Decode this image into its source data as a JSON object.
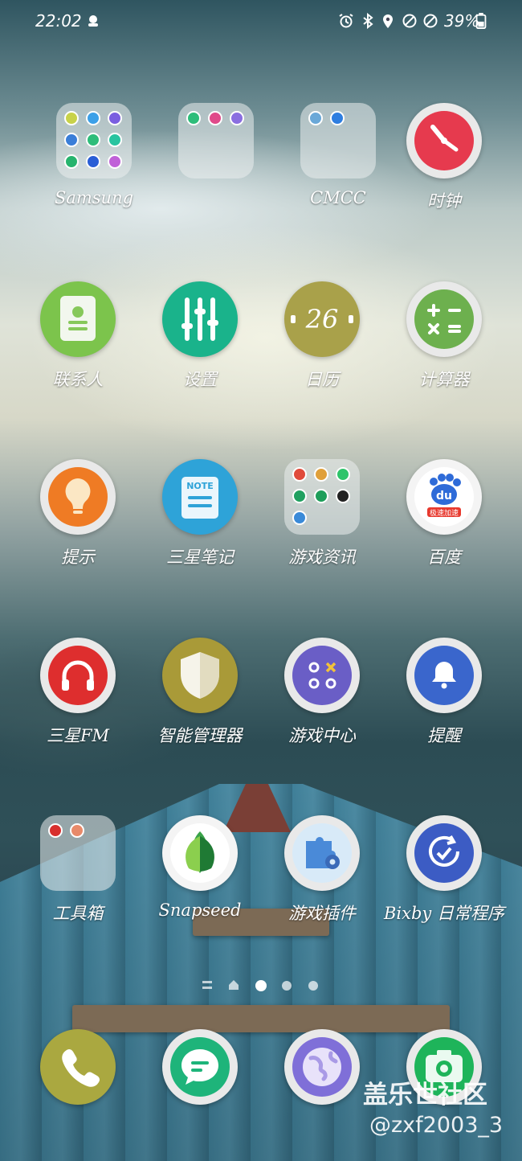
{
  "status_bar": {
    "time": "22:02",
    "battery_percent": "39%",
    "icons": [
      "notification-icon",
      "alarm-icon",
      "bluetooth-icon",
      "location-icon",
      "do-not-disturb-icon",
      "block-icon",
      "battery-icon"
    ]
  },
  "apps": {
    "samsung": {
      "label": "Samsung",
      "type": "folder"
    },
    "cmcc": {
      "label": "CMCC",
      "type": "folder"
    },
    "clock": {
      "label": "时钟",
      "icon": "clock-icon",
      "color": "#e8364c"
    },
    "contacts": {
      "label": "联系人",
      "icon": "contact-icon",
      "color": "#7ac54a"
    },
    "settings": {
      "label": "设置",
      "icon": "sliders-icon",
      "color": "#1fb08a"
    },
    "calendar": {
      "label": "日历",
      "icon": "calendar-icon",
      "color": "#a8a04a",
      "day": "26"
    },
    "calculator": {
      "label": "计算器",
      "icon": "calculator-icon",
      "color": "#6ab04c"
    },
    "tips": {
      "label": "提示",
      "icon": "bulb-icon",
      "color": "#ee7a22"
    },
    "notes": {
      "label": "三星笔记",
      "icon": "note-icon",
      "color": "#2ea3d8",
      "badge": "NOTE"
    },
    "game_news": {
      "label": "游戏资讯",
      "type": "folder"
    },
    "baidu": {
      "label": "百度",
      "icon": "baidu-icon",
      "color": "#2e6bd8",
      "text": "du",
      "tag": "极速加速"
    },
    "fm": {
      "label": "三星FM",
      "icon": "headphones-icon",
      "color": "#de2e2e"
    },
    "device_care": {
      "label": "智能管理器",
      "icon": "shield-icon",
      "color": "#a99a38"
    },
    "game_center": {
      "label": "游戏中心",
      "icon": "game-icon",
      "color": "#6a5ec6"
    },
    "reminder": {
      "label": "提醒",
      "icon": "bell-icon",
      "color": "#3a66cc"
    },
    "tools": {
      "label": "工具箱",
      "type": "folder"
    },
    "snapseed": {
      "label": "Snapseed",
      "icon": "leaf-icon",
      "color": "#3aa34a"
    },
    "game_plugins": {
      "label": "游戏插件",
      "icon": "puzzle-gear-icon",
      "color": "#4a8ad8"
    },
    "bixby": {
      "label": "Bixby 日常程序",
      "icon": "routine-icon",
      "color": "#3c5cc4"
    }
  },
  "dock": [
    {
      "name": "phone",
      "icon": "phone-icon",
      "color": "#a8a840"
    },
    {
      "name": "messages",
      "icon": "message-icon",
      "color": "#1eb47a"
    },
    {
      "name": "internet",
      "icon": "globe-icon",
      "color": "#7f6fd8"
    },
    {
      "name": "camera",
      "icon": "camera-icon",
      "color": "#1eb45a"
    }
  ],
  "pager": {
    "pages": 3,
    "current": 1
  },
  "watermark": {
    "line1": "盖乐世社区",
    "line2": "@zxf2003_3"
  }
}
